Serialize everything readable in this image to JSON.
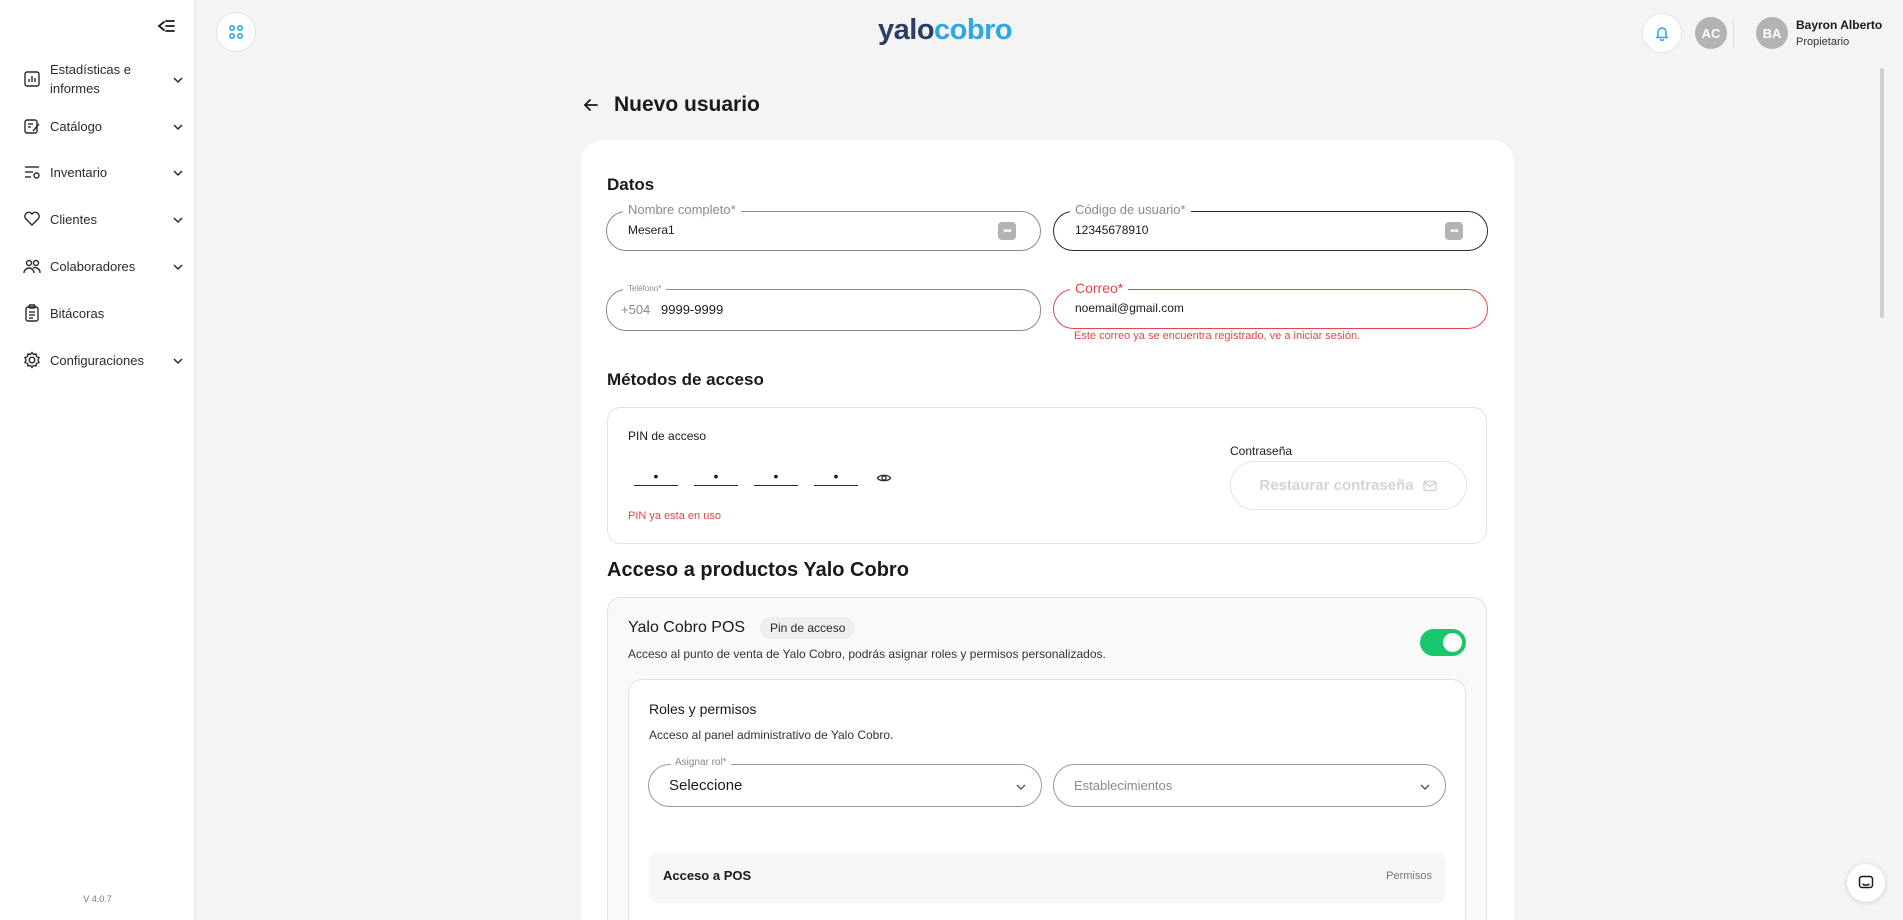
{
  "sidebar": {
    "items": [
      {
        "label": "Estadísticas e informes",
        "icon": "chart-report-icon",
        "has_chevron": true
      },
      {
        "label": "Catálogo",
        "icon": "catalog-edit-icon",
        "has_chevron": true
      },
      {
        "label": "Inventario",
        "icon": "inventory-filter-icon",
        "has_chevron": true
      },
      {
        "label": "Clientes",
        "icon": "handshake-heart-icon",
        "has_chevron": true
      },
      {
        "label": "Colaboradores",
        "icon": "people-icon",
        "has_chevron": true
      },
      {
        "label": "Bitácoras",
        "icon": "clipboard-icon",
        "has_chevron": false
      },
      {
        "label": "Configuraciones",
        "icon": "gear-icon",
        "has_chevron": true
      }
    ],
    "version": "V 4.0.7"
  },
  "header": {
    "logo_part1": "yalo",
    "logo_part2": "cobro",
    "avatar_ac": "AC",
    "avatar_ba": "BA",
    "user_name": "Bayron Alberto",
    "user_role": "Propietario"
  },
  "page": {
    "title": "Nuevo usuario"
  },
  "datos": {
    "title": "Datos",
    "nombre_label": "Nombre completo*",
    "nombre_value": "Mesera1",
    "codigo_label": "Código de usuario*",
    "codigo_value": "12345678910",
    "telefono_label": "Teléfono*",
    "telefono_prefix": "+504",
    "telefono_value": "9999-9999",
    "correo_label": "Correo*",
    "correo_value": "noemail@gmail.com",
    "correo_error": "Este correo ya se encuentra registrado, ve a iniciar sesión."
  },
  "metodos": {
    "title": "Métodos de acceso",
    "pin_label": "PIN de acceso",
    "pin_digits": [
      "•",
      "•",
      "•",
      "•"
    ],
    "pin_error": "PIN ya esta en uso",
    "password_label": "Contraseña",
    "restore_button": "Restaurar contraseña"
  },
  "productos": {
    "title": "Acceso a productos Yalo Cobro",
    "pos_title": "Yalo Cobro POS",
    "pos_badge": "Pin de acceso",
    "pos_description": "Acceso al punto de venta de Yalo Cobro, podrás asignar roles y permisos personalizados.",
    "pos_enabled": true,
    "roles_title": "Roles y permisos",
    "roles_description": "Acceso al panel administrativo de Yalo Cobro.",
    "rol_label": "Asignar rol*",
    "rol_value": "Seleccione",
    "establecimientos_placeholder": "Establecimientos",
    "acceso_pos_title": "Acceso a POS",
    "permisos_label": "Permisos"
  },
  "colors": {
    "accent": "#2ea8df",
    "brand_dark": "#2b3e66",
    "error": "#e04848",
    "toggle_on": "#18c66b"
  }
}
